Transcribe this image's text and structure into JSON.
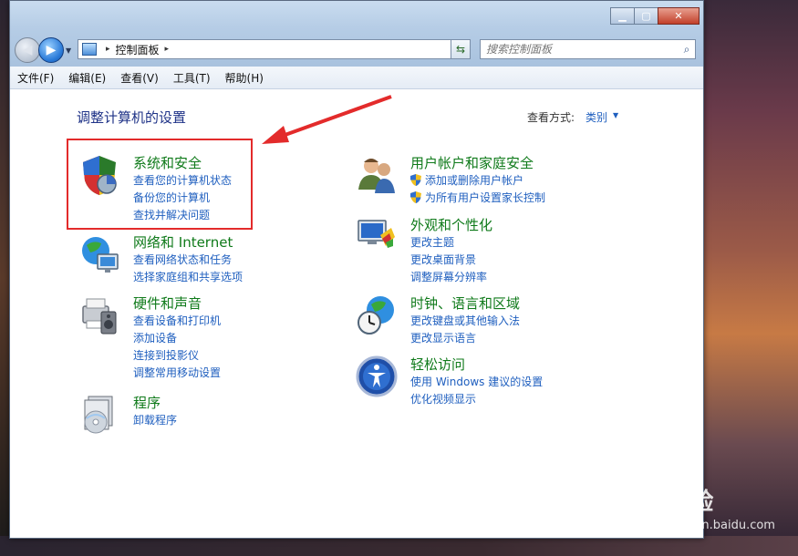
{
  "window": {
    "controls": {
      "minimize": "▁",
      "maximize": "▢",
      "close": "✕"
    }
  },
  "address_bar": {
    "separator": "▸",
    "path": "控制面板",
    "trailing_separator": "▸"
  },
  "search": {
    "placeholder": "搜索控制面板"
  },
  "menu": [
    "文件(F)",
    "编辑(E)",
    "查看(V)",
    "工具(T)",
    "帮助(H)"
  ],
  "content": {
    "title": "调整计算机的设置",
    "view_by_label": "查看方式:",
    "view_by_value": "类别"
  },
  "categories_left": [
    {
      "title": "系统和安全",
      "links": [
        "查看您的计算机状态",
        "备份您的计算机",
        "查找并解决问题"
      ]
    },
    {
      "title": "网络和 Internet",
      "links": [
        "查看网络状态和任务",
        "选择家庭组和共享选项"
      ]
    },
    {
      "title": "硬件和声音",
      "links": [
        "查看设备和打印机",
        "添加设备",
        "连接到投影仪",
        "调整常用移动设置"
      ]
    },
    {
      "title": "程序",
      "links": [
        "卸载程序"
      ]
    }
  ],
  "categories_right": [
    {
      "title": "用户帐户和家庭安全",
      "links": [
        "添加或删除用户帐户",
        "为所有用户设置家长控制"
      ]
    },
    {
      "title": "外观和个性化",
      "links": [
        "更改主题",
        "更改桌面背景",
        "调整屏幕分辨率"
      ]
    },
    {
      "title": "时钟、语言和区域",
      "links": [
        "更改键盘或其他输入法",
        "更改显示语言"
      ]
    },
    {
      "title": "轻松访问",
      "links": [
        "使用 Windows 建议的设置",
        "优化视频显示"
      ]
    }
  ],
  "watermark": {
    "line1": "Bai 经验",
    "line2": "jingyan.baidu.com"
  },
  "colors": {
    "title_blue": "#1e3287",
    "category_green": "#0f7a1a",
    "link_blue": "#1f5fbf",
    "annotation_red": "#e32b2b"
  }
}
